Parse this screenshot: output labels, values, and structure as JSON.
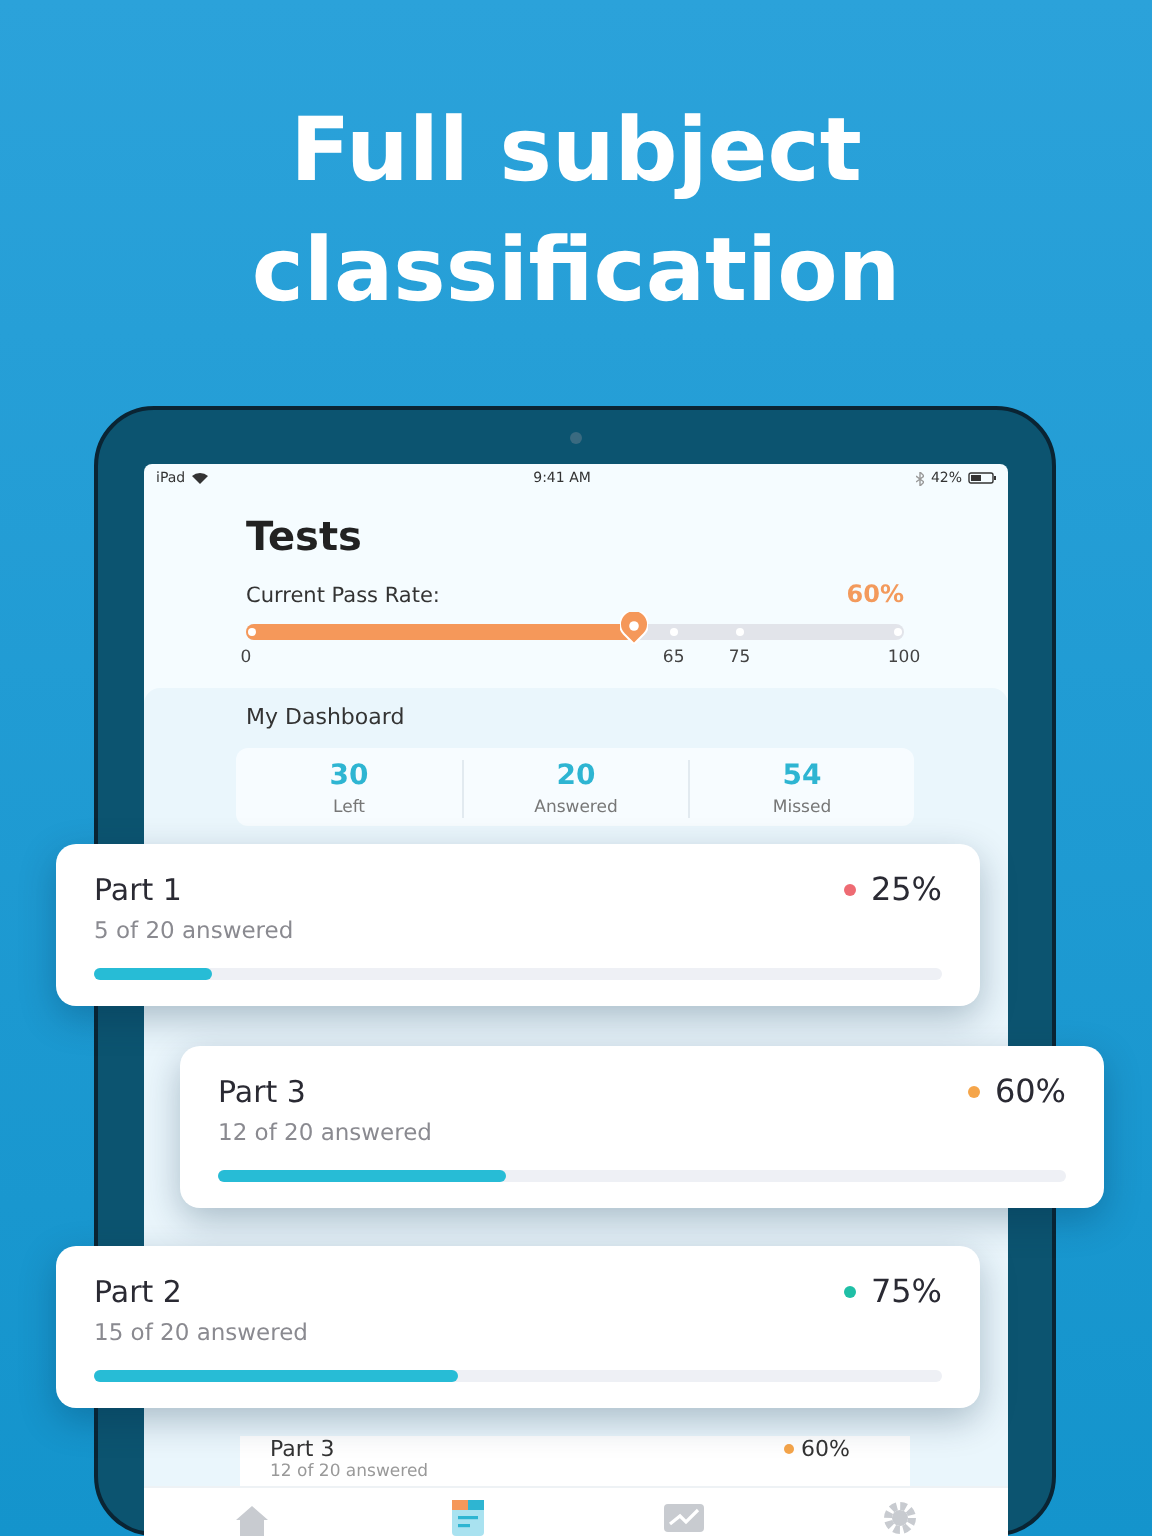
{
  "headline": "Full subject classification",
  "status_bar": {
    "carrier": "iPad",
    "time": "9:41 AM",
    "battery": "42%"
  },
  "title": "Tests",
  "pass_rate": {
    "label": "Current Pass Rate:",
    "value": "60%",
    "level": 0.59,
    "ticks": [
      "0",
      "65",
      "75",
      "100"
    ]
  },
  "dashboard": {
    "heading": "My Dashboard",
    "stats": [
      {
        "value": "30",
        "label": "Left"
      },
      {
        "value": "20",
        "label": "Answered"
      },
      {
        "value": "54",
        "label": "Missed"
      }
    ]
  },
  "list_rows": [
    {
      "name": "Part 3",
      "percent": "60%",
      "color": "#f5a54a",
      "answered": "12 of 20 answered"
    }
  ],
  "tab_bar": [
    {
      "kind": "home",
      "selected": false
    },
    {
      "kind": "tests",
      "selected": true
    },
    {
      "kind": "stats",
      "selected": false
    },
    {
      "kind": "settings",
      "selected": false
    }
  ],
  "part_cards": [
    {
      "name": "Part 1",
      "answered": "5 of 20 answered",
      "percent": "25%",
      "color": "#ee6b73",
      "level": 0.14
    },
    {
      "name": "Part 3",
      "answered": "12 of 20 answered",
      "percent": "60%",
      "color": "#f5a54a",
      "level": 0.34
    },
    {
      "name": "Part 2",
      "answered": "15 of 20 answered",
      "percent": "75%",
      "color": "#1fbfa6",
      "level": 0.43
    }
  ]
}
